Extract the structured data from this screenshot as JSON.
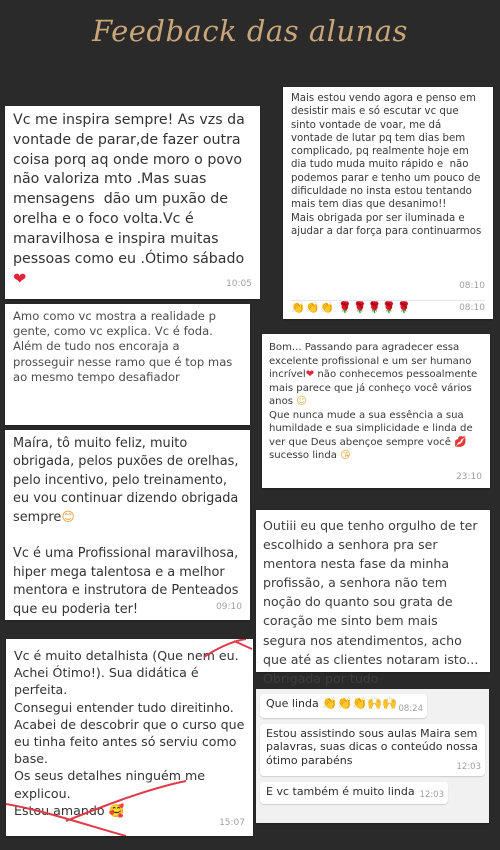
{
  "title": "Feedback das alunas",
  "cards": [
    {
      "text": "Vc me inspira sempre! As vzs da vontade de parar,de fazer outra coisa porq aq onde moro o povo não valoriza mto .Mas suas mensagens  dão um puxão de orelha e o foco volta.Vc é maravilhosa e inspira muitas pessoas como eu .Ótimo sábado",
      "time": "10:05"
    },
    {
      "text": "Mais estou vendo agora e penso em desistir mais e só escutar vc que sinto vontade de voar, me dá vontade de lutar pq tem dias bem complicado, pq realmente hoje em dia tudo muda muito rápido e  não podemos parar e tenho um pouco de dificuldade no insta estou tentando mais tem dias que desanimo!!\nMais obrigada por ser iluminada e ajudar a dar força para continuarmos",
      "time": "08:10",
      "time2": "08:10"
    },
    {
      "text": "Amo como vc mostra a realidade p gente, como vc explica. Vc é foda.\nAlém de tudo nos encoraja a prosseguir nesse ramo que é top mas ao mesmo tempo desafiador"
    },
    {
      "text_a": "Bom... Passando para agradecer essa excelente profissional e um ser humano incrível",
      "text_b": " não conhecemos pessoalmente mais parece que já conheço você vários anos ",
      "text_c": "\nQue nunca mude a sua essência a sua humildade e sua simplicidade e linda de ver que Deus abençoe sempre você",
      "text_d": "\nsucesso linda",
      "time": "23:10"
    },
    {
      "text": "Maíra, tô muito feliz, muito obrigada, pelos puxões de orelhas, pelo incentivo, pelo treinamento, eu vou continuar dizendo obrigada sempre",
      "text2": "\n\nVc é uma Profissional maravilhosa, hiper mega talentosa e a melhor mentora e instrutora de Penteados que eu poderia ter!",
      "time": "09:10"
    },
    {
      "text": "Outiii eu que tenho orgulho de ter escolhido a senhora pra ser mentora nesta fase da minha profissão, a senhora não tem noção do quanto sou grata de coração me sinto bem mais segura nos atendimentos, acho que até as clientes notaram isto... Obrigada por tudo"
    },
    {
      "text": "Vc é muito detalhista (Que nem eu. Achei Ótimo!). Sua didática é perfeita.\nConsegui entender tudo direitinho.\nAcabei de descobrir que o curso que eu tinha feito antes só serviu como base.\nOs seus detalhes ninguém me explicou.\nEstou amando ",
      "time": "15:07"
    },
    {
      "msg1": "Que linda ",
      "time1": "08:24",
      "msg2": "Estou assistindo sous aulas Maira sem palavras, suas dicas o conteúdo nossa ótimo parabéns",
      "time2": "12:03",
      "msg3": "E vc também é muito linda",
      "time3": "12:03"
    }
  ]
}
